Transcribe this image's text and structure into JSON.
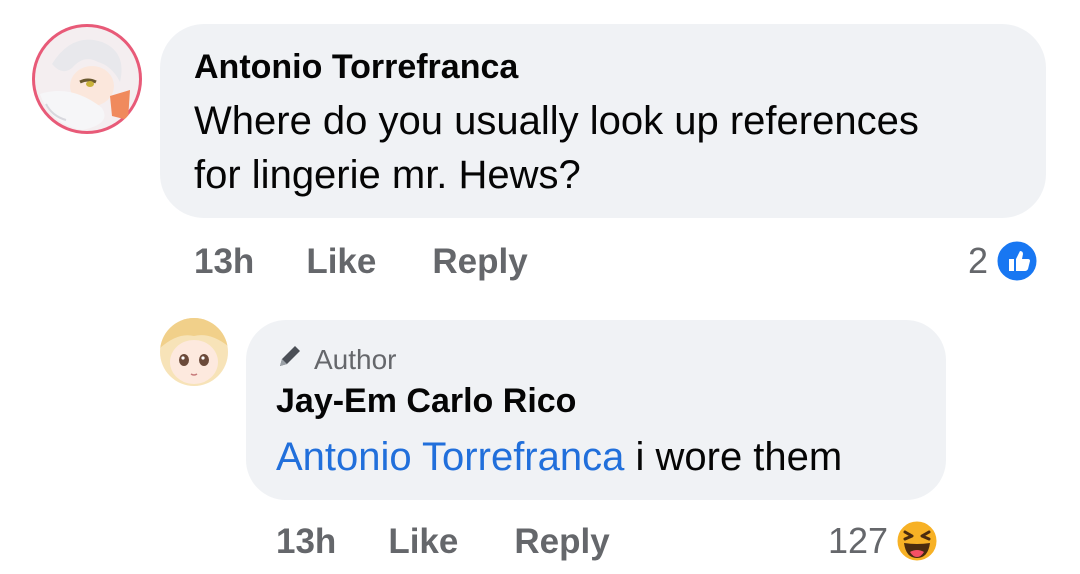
{
  "comments": [
    {
      "author": "Antonio Torrefranca",
      "text_line1": "Where do you usually look up references",
      "text_line2": "for lingerie mr. Hews?",
      "time": "13h",
      "like_label": "Like",
      "reply_label": "Reply",
      "reaction_count": "2",
      "reaction_icon": "like-icon",
      "reaction_color": "#1877f2"
    },
    {
      "badge": "Author",
      "badge_icon": "pencil-icon",
      "author": "Jay-Em Carlo Rico",
      "mention": "Antonio Torrefranca",
      "text": "i wore them",
      "time": "13h",
      "like_label": "Like",
      "reply_label": "Reply",
      "reaction_count": "127",
      "reaction_icon": "haha-icon",
      "reaction_color": "#f7b125"
    }
  ],
  "colors": {
    "bubble": "#f0f2f5",
    "secondary_text": "#65676b",
    "mention": "#216fdb"
  }
}
